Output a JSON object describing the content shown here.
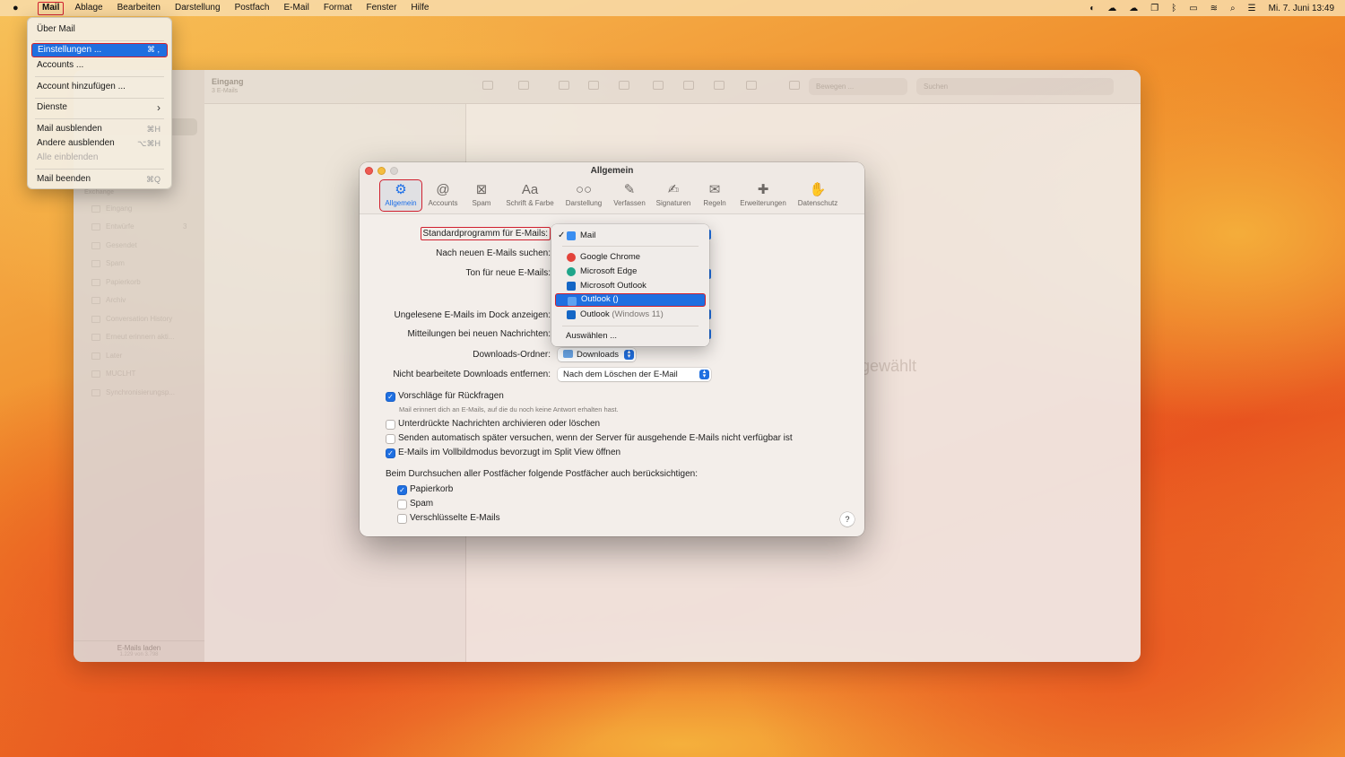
{
  "menubar": {
    "apple_icon": "apple-logo-icon",
    "items": [
      "Mail",
      "Ablage",
      "Bearbeiten",
      "Darstellung",
      "Postfach",
      "E-Mail",
      "Format",
      "Fenster",
      "Hilfe"
    ],
    "clock": "Mi. 7. Juni  13:49"
  },
  "app_menu": {
    "items": [
      {
        "label": "Über Mail",
        "shortcut": ""
      },
      {
        "label": "Einstellungen ...",
        "shortcut": "⌘ ,"
      },
      {
        "label": "Accounts ...",
        "shortcut": ""
      },
      {
        "label": "Account hinzufügen ...",
        "shortcut": ""
      },
      {
        "label": "Dienste",
        "shortcut": "›"
      },
      {
        "label": "Mail ausblenden",
        "shortcut": "⌘H"
      },
      {
        "label": "Andere ausblenden",
        "shortcut": "⌥⌘H"
      },
      {
        "label": "Alle einblenden",
        "shortcut": ""
      },
      {
        "label": "Mail beenden",
        "shortcut": "⌘Q"
      }
    ]
  },
  "mail_window": {
    "list_title": "Eingang",
    "list_subtitle": "3 E-Mails",
    "search_placeholder": "Suchen",
    "move_placeholder": "Bewegen ...",
    "sidebar_section": "Exchange",
    "sidebar_items": [
      "Eingang",
      "Entwürfe",
      "Gesendet",
      "Spam",
      "Papierkorb",
      "Archiv",
      "Conversation History",
      "Erneut erinnern akti...",
      "Later",
      "MUCLHT",
      "Synchronisierungsp..."
    ],
    "sidebar_badge": "3",
    "footer_title": "E-Mails laden",
    "footer_sub": "1.229 von 3.798",
    "empty_text": "gewählt"
  },
  "dialog": {
    "title": "Allgemein",
    "tabs": [
      {
        "label": "Allgemein",
        "icon": "gear-icon",
        "glyph": "⚙"
      },
      {
        "label": "Accounts",
        "icon": "at-icon",
        "glyph": "@"
      },
      {
        "label": "Spam",
        "icon": "trash-tray-icon",
        "glyph": "⊠"
      },
      {
        "label": "Schrift & Farbe",
        "icon": "font-icon",
        "glyph": "Aa"
      },
      {
        "label": "Darstellung",
        "icon": "glasses-icon",
        "glyph": "○○"
      },
      {
        "label": "Verfassen",
        "icon": "compose-icon",
        "glyph": "✎"
      },
      {
        "label": "Signaturen",
        "icon": "signature-icon",
        "glyph": "✍"
      },
      {
        "label": "Regeln",
        "icon": "envelope-rules-icon",
        "glyph": "✉"
      },
      {
        "label": "Erweiterungen",
        "icon": "puzzle-icon",
        "glyph": "✚"
      },
      {
        "label": "Datenschutz",
        "icon": "hand-icon",
        "glyph": "✋"
      }
    ],
    "labels": {
      "default_mail": "Standardprogramm für E-Mails:",
      "check_mail": "Nach neuen E-Mails suchen:",
      "sound": "Ton für neue E-Mails:",
      "dock_unread": "Ungelesene E-Mails im Dock anzeigen:",
      "notifications": "Mitteilungen bei neuen Nachrichten:",
      "downloads_folder": "Downloads-Ordner:",
      "remove_downloads": "Nicht bearbeitete Downloads entfernen:"
    },
    "downloads_value": "Downloads",
    "remove_downloads_value": "Nach dem Löschen der E-Mail",
    "checkboxes": [
      {
        "label": "Vorschläge für Rückfragen",
        "checked": true
      },
      {
        "label": "Unterdrückte Nachrichten archivieren oder löschen",
        "checked": false
      },
      {
        "label": "Senden automatisch später versuchen, wenn der Server für ausgehende E-Mails nicht verfügbar ist",
        "checked": false
      },
      {
        "label": "E-Mails im Vollbildmodus bevorzugt im Split View öffnen",
        "checked": true
      }
    ],
    "followup_hint": "Mail erinnert dich an E-Mails, auf die du noch keine Antwort erhalten hast.",
    "search_section": "Beim Durchsuchen aller Postfächer folgende Postfächer auch berücksichtigen:",
    "search_boxes": [
      {
        "label": "Papierkorb",
        "checked": true
      },
      {
        "label": "Spam",
        "checked": false
      },
      {
        "label": "Verschlüsselte E-Mails",
        "checked": false
      }
    ],
    "help_label": "?"
  },
  "default_app_menu": {
    "checkmark": "✓",
    "items": [
      {
        "label": "Mail",
        "version": "",
        "icon": "mail-app-icon",
        "color": "#3b8ef0"
      },
      {
        "label": "Google Chrome",
        "version": "",
        "icon": "chrome-app-icon",
        "color": "#e3433a"
      },
      {
        "label": "Microsoft Edge",
        "version": "",
        "icon": "edge-app-icon",
        "color": "#1fa58a"
      },
      {
        "label": "Microsoft Outlook",
        "version": "",
        "icon": "outlook-app-icon",
        "color": "#1466c5"
      },
      {
        "label": "Outlook ()",
        "version": "",
        "icon": "outlook-app-icon",
        "color": "#1466c5"
      },
      {
        "label": "Outlook",
        "version": "(Windows 11)",
        "icon": "outlook-app-icon",
        "color": "#1466c5"
      }
    ],
    "choose": "Auswählen ..."
  }
}
